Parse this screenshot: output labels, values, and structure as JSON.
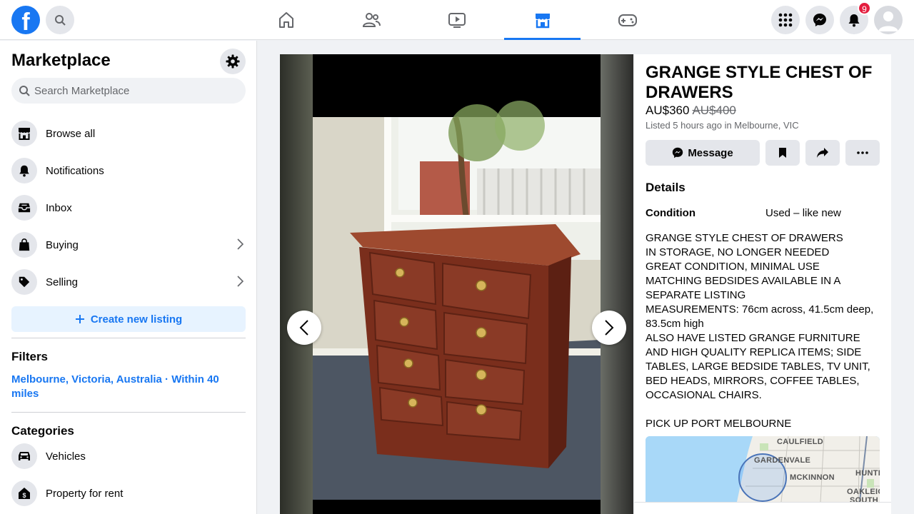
{
  "topbar": {
    "logo": "f",
    "notifications_count": "9",
    "nav_tabs": [
      "home",
      "friends",
      "watch",
      "marketplace",
      "gaming"
    ],
    "active_tab": "marketplace"
  },
  "sidebar": {
    "title": "Marketplace",
    "search_placeholder": "Search Marketplace",
    "items": [
      {
        "label": "Browse all",
        "icon": "store-icon"
      },
      {
        "label": "Notifications",
        "icon": "bell-icon"
      },
      {
        "label": "Inbox",
        "icon": "inbox-icon"
      },
      {
        "label": "Buying",
        "icon": "shopping-bag-icon"
      },
      {
        "label": "Selling",
        "icon": "tag-icon"
      }
    ],
    "create_label": "Create new listing",
    "filters_title": "Filters",
    "location_filter": "Melbourne, Victoria, Australia · Within 40 miles",
    "categories_title": "Categories",
    "categories": [
      {
        "label": "Vehicles",
        "icon": "car-icon"
      },
      {
        "label": "Property for rent",
        "icon": "house-dollar-icon"
      }
    ]
  },
  "listing": {
    "title": "GRANGE STYLE CHEST OF DRAWERS",
    "price": "AU$360",
    "old_price": "AU$400",
    "listed": "Listed 5 hours ago in Melbourne, VIC",
    "message_label": "Message",
    "details_title": "Details",
    "condition_label": "Condition",
    "condition_value": "Used – like new",
    "description": [
      "GRANGE STYLE CHEST OF DRAWERS",
      "IN STORAGE, NO LONGER NEEDED",
      "GREAT CONDITION, MINIMAL USE",
      "MATCHING BEDSIDES AVAILABLE IN A SEPARATE LISTING",
      "MEASUREMENTS: 76cm across, 41.5cm deep, 83.5cm high",
      "ALSO HAVE LISTED GRANGE FURNITURE AND HIGH QUALITY REPLICA ITEMS; SIDE TABLES, LARGE BEDSIDE TABLES, TV UNIT, BED HEADS, MIRRORS, COFFEE TABLES, OCCASIONAL CHAIRS.",
      "",
      "PICK UP PORT MELBOURNE"
    ],
    "map_labels": [
      "CAULFIELD",
      "GARDENVALE",
      "MCKINNON",
      "HUNTI",
      "OAKLEIG",
      "SOUTH"
    ]
  }
}
